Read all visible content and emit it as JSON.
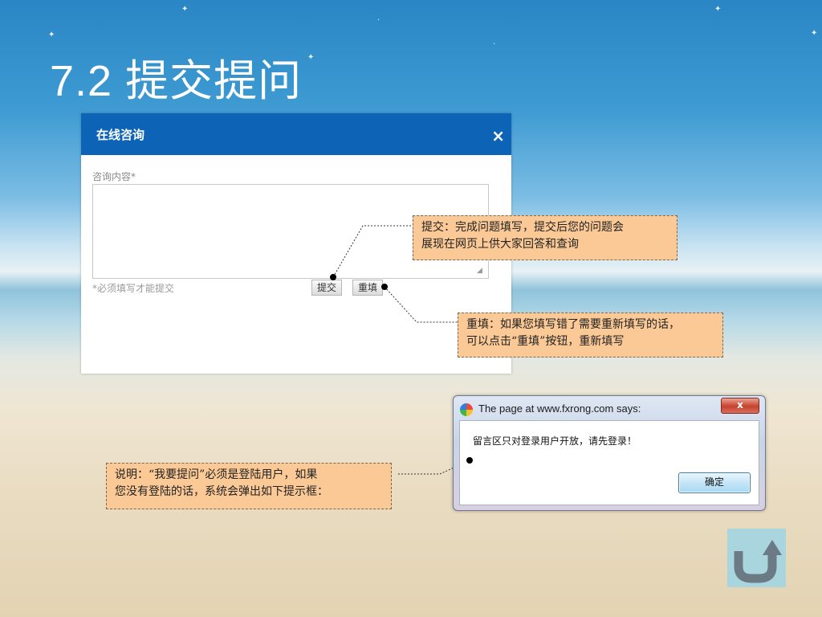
{
  "slide": {
    "title": "7.2 提交提问"
  },
  "consult_dialog": {
    "title": "在线咨询",
    "close_glyph": "×",
    "content_label": "咨询内容*",
    "content_value": "",
    "required_note": "*必须填写才能提交",
    "submit_label": "提交",
    "reset_label": "重填"
  },
  "callouts": {
    "submit_line1": "提交：完成问题填写，提交后您的问题会",
    "submit_line2": "展现在网页上供大家回答和查询",
    "reset_line1": "重填：如果您填写错了需要重新填写的话，",
    "reset_line2": "可以点击“重填”按钮，重新填写",
    "note_line1": "说明：“我要提问”必须是登陆用户，如果",
    "note_line2": "您没有登陆的话，系统会弹出如下提示框："
  },
  "alert_dialog": {
    "title": "The page at www.fxrong.com says:",
    "close_glyph": "x",
    "message": "留言区只对登录用户开放，请先登录！",
    "ok_label": "确定"
  },
  "return_button": {
    "icon": "u-turn-arrow-icon",
    "color": "#a9d5de"
  },
  "colors": {
    "dialog_header": "#0d63b5",
    "callout_fill": "#fbc996"
  }
}
